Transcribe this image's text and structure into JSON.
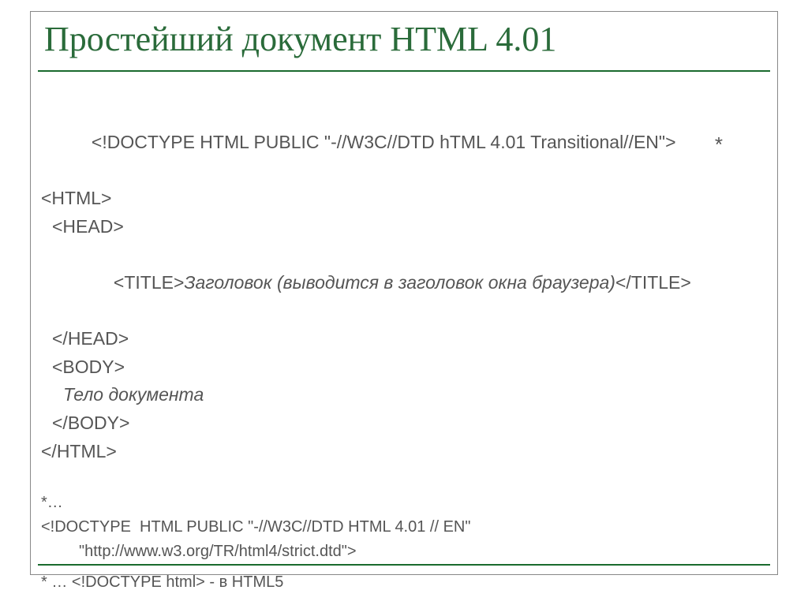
{
  "title": "Простейший документ HTML 4.01",
  "code": {
    "l1": "<!DOCTYPE HTML PUBLIC \"-//W3C//DTD hTML 4.01 Transitional//EN\">",
    "star": " *",
    "l2": "<HTML>",
    "l3": "<HEAD>",
    "l4a": "<TITLE>",
    "l4b": "Заголовок (выводится в заголовок окна браузера)",
    "l4c": "</TITLE>",
    "l5": "</HEAD>",
    "l6": "<BODY>",
    "l7": "Тело документа",
    "l8": "</BODY>",
    "l9": "</HTML>"
  },
  "notes": {
    "n1": "*…",
    "n2a": "<!DOCTYPE  HTML PUBLIC \"-//W3C//DTD HTML 4.01 // EN\"",
    "n2b": "\"http://www.w3.org/TR/html4/strict.dtd\">",
    "n3": "* … <!DOCTYPE html> - в HTML5"
  }
}
